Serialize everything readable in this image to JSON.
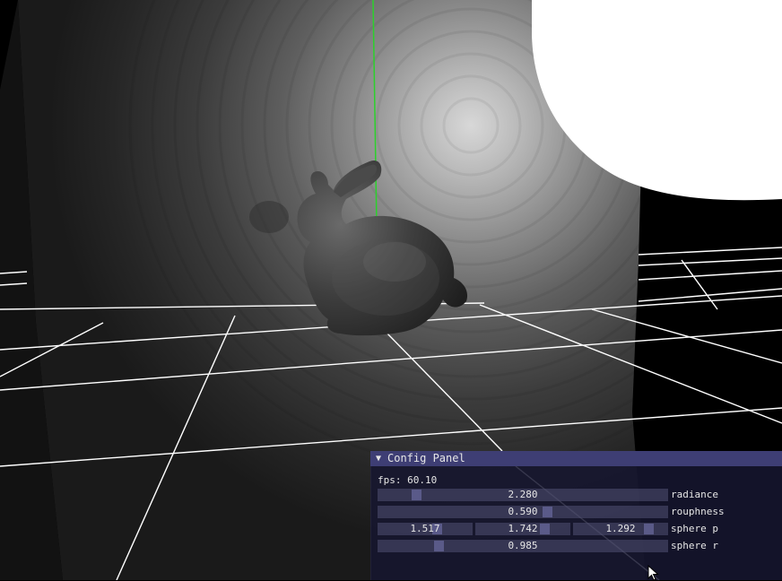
{
  "window": {
    "panel_title": "Config Panel",
    "collapse_arrow": "triangle-down-icon"
  },
  "panel": {
    "fps_text": "fps: 60.10",
    "radiance": {
      "value": "2.280",
      "label": "radiance"
    },
    "rouphness": {
      "value": "0.590",
      "label": "rouphness"
    },
    "sphere_p": {
      "values": [
        "1.517",
        "1.742",
        "1.292"
      ],
      "label": "sphere p"
    },
    "sphere_r": {
      "value": "0.985",
      "label": "sphere r"
    }
  },
  "scene": {
    "background_color": "#000000",
    "grid_color": "#ffffff",
    "axis_color": "#2bd12b",
    "sphere_color": "#ffffff",
    "model": "bunny"
  }
}
